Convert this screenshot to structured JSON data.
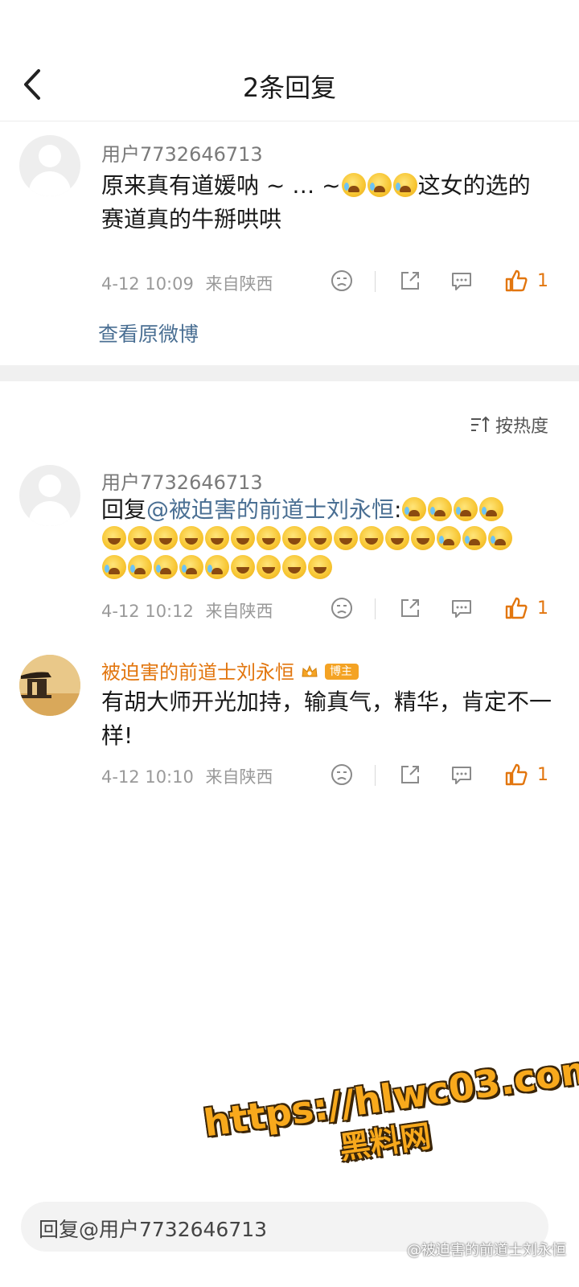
{
  "header": {
    "title": "2条回复"
  },
  "main_comment": {
    "username": "用户7732646713",
    "text_part1": "原来真有道媛呐 ~ … ~",
    "text_part2": "这女的选的赛道真的牛掰哄哄",
    "emojis": [
      "cry-laugh",
      "cry-laugh",
      "cry-laugh"
    ],
    "date": "4-12 10:09",
    "location": "来自陕西",
    "likes": "1",
    "view_original": "查看原微博"
  },
  "sort": {
    "label": "按热度"
  },
  "replies": [
    {
      "username": "用户7732646713",
      "reply_prefix": "回复",
      "mention": "@被迫害的前道士刘永恒",
      "colon": ":",
      "emoji_line1": [
        "cry-laugh",
        "cry-laugh",
        "cry-laugh",
        "cry-laugh"
      ],
      "emoji_line2": [
        "laugh",
        "laugh",
        "laugh",
        "laugh",
        "laugh",
        "laugh",
        "laugh",
        "laugh",
        "laugh",
        "laugh",
        "laugh",
        "laugh",
        "laugh",
        "cry-laugh",
        "cry-laugh",
        "cry-laugh"
      ],
      "emoji_line3": [
        "cry-laugh",
        "cry-laugh",
        "cry-laugh",
        "cry-laugh",
        "cry-laugh",
        "laugh",
        "laugh",
        "laugh",
        "laugh"
      ],
      "date": "4-12 10:12",
      "location": "来自陕西",
      "likes": "1"
    },
    {
      "username": "被迫害的前道士刘永恒",
      "badge": "博主",
      "text": "有胡大师开光加持，输真气，精华，肯定不一样!",
      "date": "4-12 10:10",
      "location": "来自陕西",
      "likes": "1"
    }
  ],
  "watermark": {
    "line1": "https://hlwc03.com",
    "line2": "黑料网"
  },
  "reply_bar": {
    "placeholder": "回复@用户7732646713"
  },
  "source_watermark": "@被迫害的前道士刘永恒",
  "colors": {
    "accent_orange": "#e2760f",
    "link_blue": "#4a6f93",
    "meta_gray": "#9a9a9a"
  }
}
